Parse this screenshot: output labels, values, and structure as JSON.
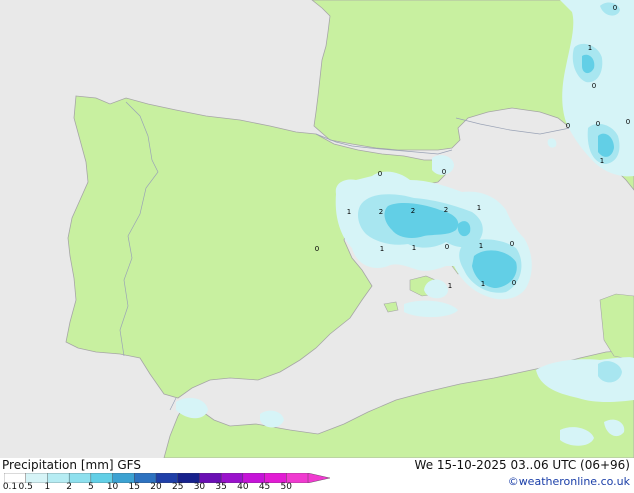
{
  "map": {
    "colors": {
      "sea": "#e9e9e9",
      "land": "#c8f0a0",
      "coast": "#a6a6a6",
      "border": "#9aa3b6",
      "precip_light": "#d6f4f7",
      "precip_mid": "#a8e6f0",
      "precip_heavy": "#62cfe6"
    },
    "point_labels": [
      "0",
      "0",
      "1",
      "2",
      "2",
      "2",
      "1",
      "0",
      "1",
      "1",
      "0",
      "1",
      "0",
      "1",
      "1",
      "0",
      "1",
      "0",
      "0",
      "0",
      "1",
      "0",
      "0"
    ]
  },
  "legend": {
    "title": "Precipitation [mm]  GFS",
    "values": [
      "0.1",
      "0.5",
      "1",
      "2",
      "5",
      "10",
      "15",
      "20",
      "25",
      "30",
      "35",
      "40",
      "45",
      "50"
    ],
    "colors": [
      "#ffffff",
      "#d6f4f7",
      "#b6ecf3",
      "#8ee0ee",
      "#62cfe6",
      "#3ca2d2",
      "#2d72c0",
      "#1f3fa8",
      "#17218c",
      "#6a0fb4",
      "#9a12cc",
      "#c513d8",
      "#e21bd4",
      "#f03ad0"
    ]
  },
  "valid_time": "We 15-10-2025 03..06 UTC (06+96)",
  "credit": "©weatheronline.co.uk"
}
